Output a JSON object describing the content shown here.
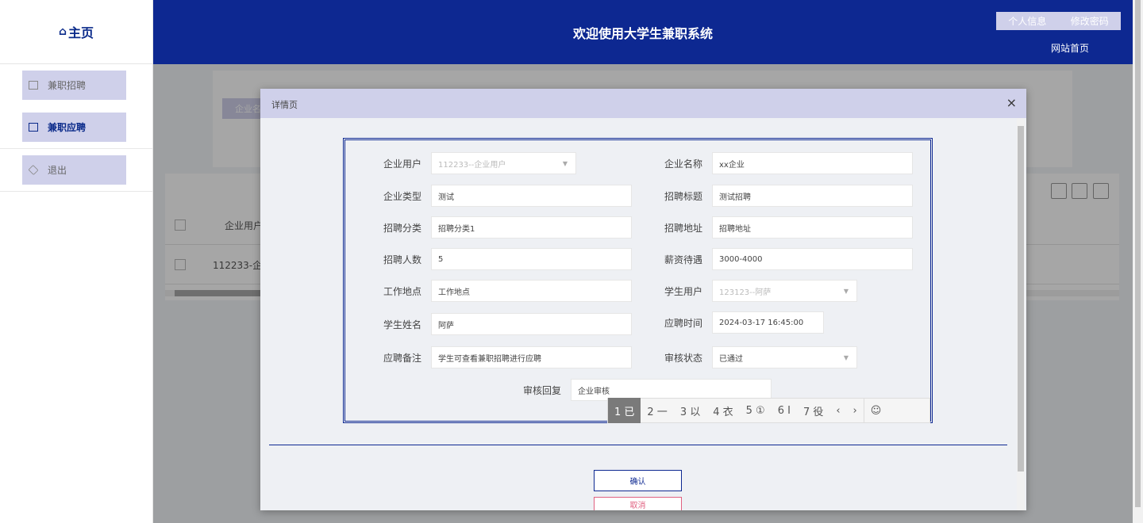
{
  "sidebar": {
    "brand": "主页",
    "items": [
      {
        "label": "兼职招聘"
      },
      {
        "label": "兼职应聘"
      },
      {
        "label": "退出"
      }
    ]
  },
  "header": {
    "title": "欢迎使用大学生兼职系统",
    "personal_info": "个人信息",
    "change_password": "修改密码",
    "site_home": "网站首页"
  },
  "background": {
    "search_chip": "企业名",
    "col_enterprise_user": "企业用户",
    "row_enterprise_user": "112233-企"
  },
  "modal": {
    "title": "详情页",
    "close": "×",
    "fields": {
      "enterprise_user_label": "企业用户",
      "enterprise_user_value": "112233--企业用户",
      "enterprise_name_label": "企业名称",
      "enterprise_name_value": "xx企业",
      "enterprise_type_label": "企业类型",
      "enterprise_type_value": "测试",
      "recruit_title_label": "招聘标题",
      "recruit_title_value": "测试招聘",
      "recruit_category_label": "招聘分类",
      "recruit_category_value": "招聘分类1",
      "recruit_address_label": "招聘地址",
      "recruit_address_value": "招聘地址",
      "recruit_count_label": "招聘人数",
      "recruit_count_value": "5",
      "salary_label": "薪资待遇",
      "salary_value": "3000-4000",
      "work_place_label": "工作地点",
      "work_place_value": "工作地点",
      "student_user_label": "学生用户",
      "student_user_value": "123123--阿萨",
      "student_name_label": "学生姓名",
      "student_name_value": "阿萨",
      "apply_time_label": "应聘时间",
      "apply_time_value": "2024-03-17 16:45:00",
      "apply_note_label": "应聘备注",
      "apply_note_value": "学生可查看兼职招聘进行应聘",
      "review_status_label": "审核状态",
      "review_status_value": "已通过",
      "review_reply_label": "审核回复",
      "review_reply_value": "企业审核"
    },
    "ime_candidates": [
      "1 已",
      "2 一",
      "3 以",
      "4 衣",
      "5 ①",
      "6 I",
      "7 役",
      "‹",
      "›",
      "☺"
    ],
    "confirm": "确认",
    "cancel": "取消"
  }
}
